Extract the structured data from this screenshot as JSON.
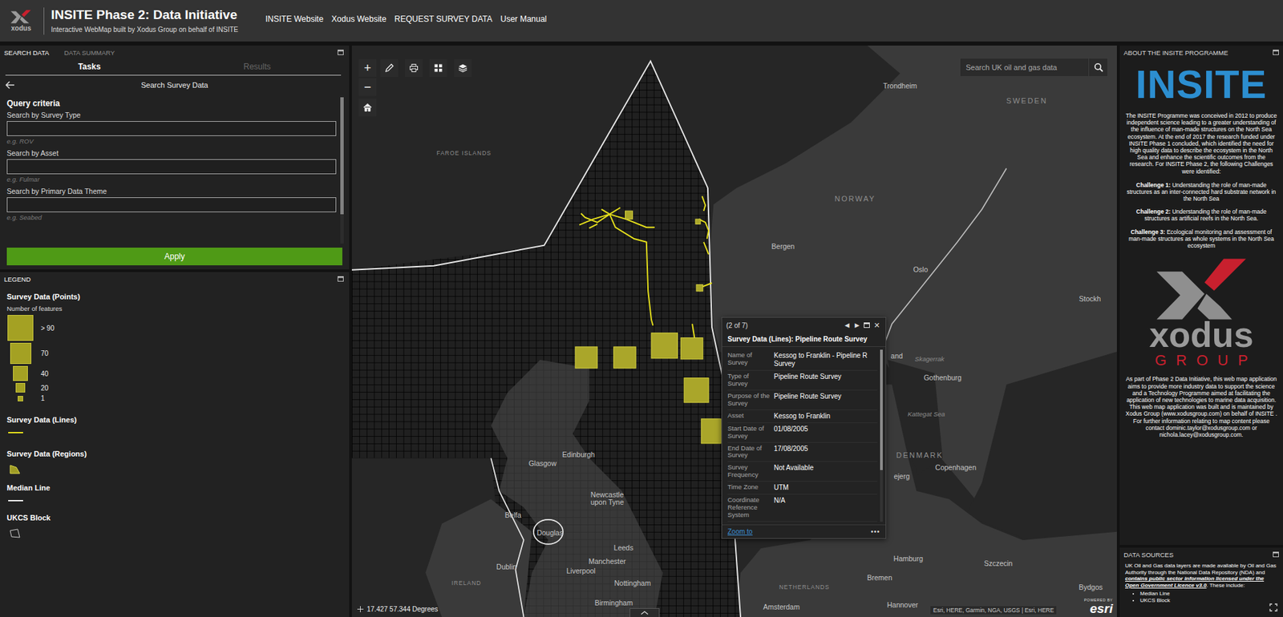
{
  "header": {
    "logo": "xodus",
    "title": "INSITE Phase 2: Data Initiative",
    "subtitle": "Interactive WebMap built by Xodus Group on behalf of INSITE",
    "nav": [
      "INSITE Website",
      "Xodus Website",
      "REQUEST SURVEY DATA",
      "User Manual"
    ]
  },
  "search_panel": {
    "tabs": [
      {
        "label": "SEARCH DATA",
        "selected": true
      },
      {
        "label": "DATA SUMMARY",
        "selected": false
      }
    ],
    "subtabs": [
      {
        "label": "Tasks",
        "selected": true
      },
      {
        "label": "Results",
        "selected": false
      }
    ],
    "title": "Search Survey Data",
    "section": "Query criteria",
    "fields": [
      {
        "label": "Search by Survey Type",
        "value": "",
        "hint": "e.g. ROV"
      },
      {
        "label": "Search by Asset",
        "value": "",
        "hint": "e.g. Fulmar"
      },
      {
        "label": "Search by Primary Data Theme",
        "value": "",
        "hint": "e.g. Seabed"
      }
    ],
    "button": "Apply"
  },
  "legend": {
    "title": "LEGEND",
    "groups": [
      {
        "title": "Survey Data (Points)",
        "kind": "points",
        "subtitle": "Number of features",
        "items": [
          "> 90",
          "70",
          "40",
          "20",
          "1"
        ]
      },
      {
        "title": "Survey Data (Lines)",
        "kind": "line"
      },
      {
        "title": "Survey Data (Regions)",
        "kind": "region"
      },
      {
        "title": "Median Line",
        "kind": "median"
      },
      {
        "title": "UKCS Block",
        "kind": "block"
      }
    ]
  },
  "map": {
    "zoom_in": "+",
    "zoom_out": "−",
    "search_placeholder": "Search UK oil and gas data",
    "labels": [
      {
        "text": "Trondheim",
        "kind": "city"
      },
      {
        "text": "SWEDEN",
        "kind": "country"
      },
      {
        "text": "FAROE ISLANDS",
        "kind": "region"
      },
      {
        "text": "NORWAY",
        "kind": "country"
      },
      {
        "text": "Bergen",
        "kind": "city"
      },
      {
        "text": "Oslo",
        "kind": "city"
      },
      {
        "text": "Stockh",
        "kind": "city"
      },
      {
        "text": "and",
        "kind": "city"
      },
      {
        "text": "Skagerrak",
        "kind": "sea"
      },
      {
        "text": "Gothenburg",
        "kind": "city"
      },
      {
        "text": "Kattegat Sea",
        "kind": "sea"
      },
      {
        "text": "DENMARK",
        "kind": "country"
      },
      {
        "text": "Copenhagen",
        "kind": "city"
      },
      {
        "text": "ejerg",
        "kind": "city"
      },
      {
        "text": "Edinburgh",
        "kind": "city"
      },
      {
        "text": "Glasgow",
        "kind": "city"
      },
      {
        "text": "Newcastle\nupon Tyne",
        "kind": "city"
      },
      {
        "text": "Belfa",
        "kind": "city"
      },
      {
        "text": "Douglas",
        "kind": "city"
      },
      {
        "text": "Dublin",
        "kind": "city"
      },
      {
        "text": "IRELAND",
        "kind": "region"
      },
      {
        "text": "Leeds",
        "kind": "city"
      },
      {
        "text": "Manchester",
        "kind": "city"
      },
      {
        "text": "Liverpool",
        "kind": "city"
      },
      {
        "text": "Nottingham",
        "kind": "city"
      },
      {
        "text": "Birmingham",
        "kind": "city"
      },
      {
        "text": "Hamburg",
        "kind": "city"
      },
      {
        "text": "Bremen",
        "kind": "city"
      },
      {
        "text": "Hannover",
        "kind": "city"
      },
      {
        "text": "Szczecin",
        "kind": "city"
      },
      {
        "text": "Bydgos",
        "kind": "city"
      },
      {
        "text": "NETHERLANDS",
        "kind": "region"
      },
      {
        "text": "Amsterdam",
        "kind": "city"
      }
    ],
    "coordinates": "17.427 57.344 Degrees",
    "attribution": "Esri, HERE, Garmin, NGA, USGS | Esri, HERE",
    "powered_by": "POWERED BY",
    "esri": "esri"
  },
  "popup": {
    "counter": "(2 of 7)",
    "prev": "◀",
    "next": "▶",
    "close": "✕",
    "title": "Survey Data (Lines): Pipeline Route Survey",
    "fields": [
      {
        "label": "Name of Survey",
        "value": "Kessog to Franklin - Pipeline R\nSurvey"
      },
      {
        "label": "Type of Survey",
        "value": "Pipeline Route Survey"
      },
      {
        "label": "Purpose of the Survey",
        "value": "Pipeline Route Survey"
      },
      {
        "label": "Asset",
        "value": "Kessog to Franklin"
      },
      {
        "label": "Start Date of Survey",
        "value": "01/08/2005"
      },
      {
        "label": "End Date of Survey",
        "value": "17/08/2005"
      },
      {
        "label": "Survey Frequency",
        "value": "Not Available"
      },
      {
        "label": "Time Zone",
        "value": "UTM"
      },
      {
        "label": "Coordinate Reference System",
        "value": "N/A"
      }
    ],
    "link": "Zoom to",
    "more": "•••"
  },
  "about": {
    "title": "ABOUT THE INSITE PROGRAMME",
    "logo": "INSITE",
    "intro": "The INSITE Programme was conceived in 2012 to produce independent science leading to a greater understanding of the influence of man-made structures on the North Sea ecosystem. At the end of 2017 the research funded under INSITE Phase 1 concluded, which identified the need for high quality data to describe the ecosystem in the North Sea and enhance the scientific outcomes from the research. For INSITE Phase 2, the following Challenges were identified:",
    "challenges": [
      {
        "label": "Challenge 1:",
        "text": "Understanding the role of man-made structures as an inter-connected hard substrate network in the North Sea"
      },
      {
        "label": "Challenge 2:",
        "text": "Understanding the role of man-made structures as artificial reefs in the North Sea."
      },
      {
        "label": "Challenge 3:",
        "text": "Ecological monitoring and assessment of man-made structures as whole systems in the North Sea ecosystem"
      }
    ],
    "partner_logo": "xodus",
    "partner_sub": "GROUP",
    "outro": "As part of Phase 2 Data Initiative, this web map application aims to provide more industry data to support the science and a Technology Programme aimed at facilitating the application of new technologies to marine data acquisition. This web map application was built and is maintained by Xodus Group (www.xodusgroup.com) on behalf of INSITE . For further information relating to map content please contact dominic.taylor@xodusgroup.com or nichola.lacey@xodusgroup.com."
  },
  "data_sources": {
    "title": "DATA SOURCES",
    "text": "UK Oil and Gas data layers are made available by Oil and Gas Authority through the National Data Repository (NDA) and",
    "link": "contains public sector information licensed under the Open Government Licence v3.0",
    "suffix": ". These include:",
    "items": [
      "Median Line",
      "UKCS Block"
    ]
  }
}
